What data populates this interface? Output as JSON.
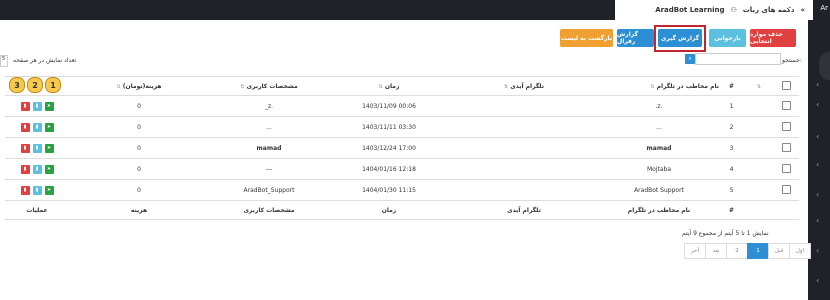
{
  "topbar": {
    "app_name": "AradBot Learning",
    "breadcrumb_current": "دکمه های ربات",
    "home": "خانه",
    "corner": "Ar"
  },
  "toolbar": {
    "delete_selected": "حذف موارد انتخابی",
    "back_to_list": "بازخوانی",
    "reporting": "گزارش گیری",
    "referral_report": "گزارش رفرال",
    "return_to_list": "بازگشت به لیست"
  },
  "page_size": {
    "label": "تعداد نمایش در هر صفحه",
    "value": "5"
  },
  "search": {
    "label": "جستجو:",
    "value": ""
  },
  "table": {
    "headers": [
      "#",
      "نام مخاطب در تلگرام",
      "تلگرام آیدی",
      "زمان",
      "مشخصات کاربری",
      "هزینه(تومان)",
      ""
    ],
    "footer": [
      "#",
      "نام مخاطب در تلگرام",
      "تلگرام آیدی",
      "زمان",
      "مشخصات کاربری",
      "هزینه",
      "عملیات"
    ],
    "rows": [
      {
        "n": "1",
        "name": ".z.",
        "tid": "",
        "time": "1403/11/09 00:06",
        "profile": "_z.",
        "cost": "0"
      },
      {
        "n": "2",
        "name": "...",
        "tid": "",
        "time": "1403/11/11 03:30",
        "profile": "...",
        "cost": "0"
      },
      {
        "n": "3",
        "name": "mamad",
        "tid": "",
        "time": "1403/12/24 17:00",
        "profile": "mamad",
        "cost": "0"
      },
      {
        "n": "4",
        "name": "Mojtaba",
        "tid": "",
        "time": "1404/01/16 12:18",
        "profile": "---",
        "cost": "0"
      },
      {
        "n": "5",
        "name": "AradBot Support",
        "tid": "",
        "time": "1404/01/30 11:15",
        "profile": "AradBot_Support",
        "cost": "0"
      }
    ]
  },
  "annotations": [
    "1",
    "2",
    "3"
  ],
  "summary": "نمایش 1 تا 5 آیتم از مجموع 9 آیتم",
  "pagination": [
    "اول",
    "قبل",
    "1",
    "2",
    "بعد",
    "آخر"
  ],
  "colors": {
    "delete": "#e04040",
    "blue": "#5bc0de",
    "dark_blue": "#2c8fd3",
    "orange": "#f0a030",
    "dark": "#1f2329"
  }
}
